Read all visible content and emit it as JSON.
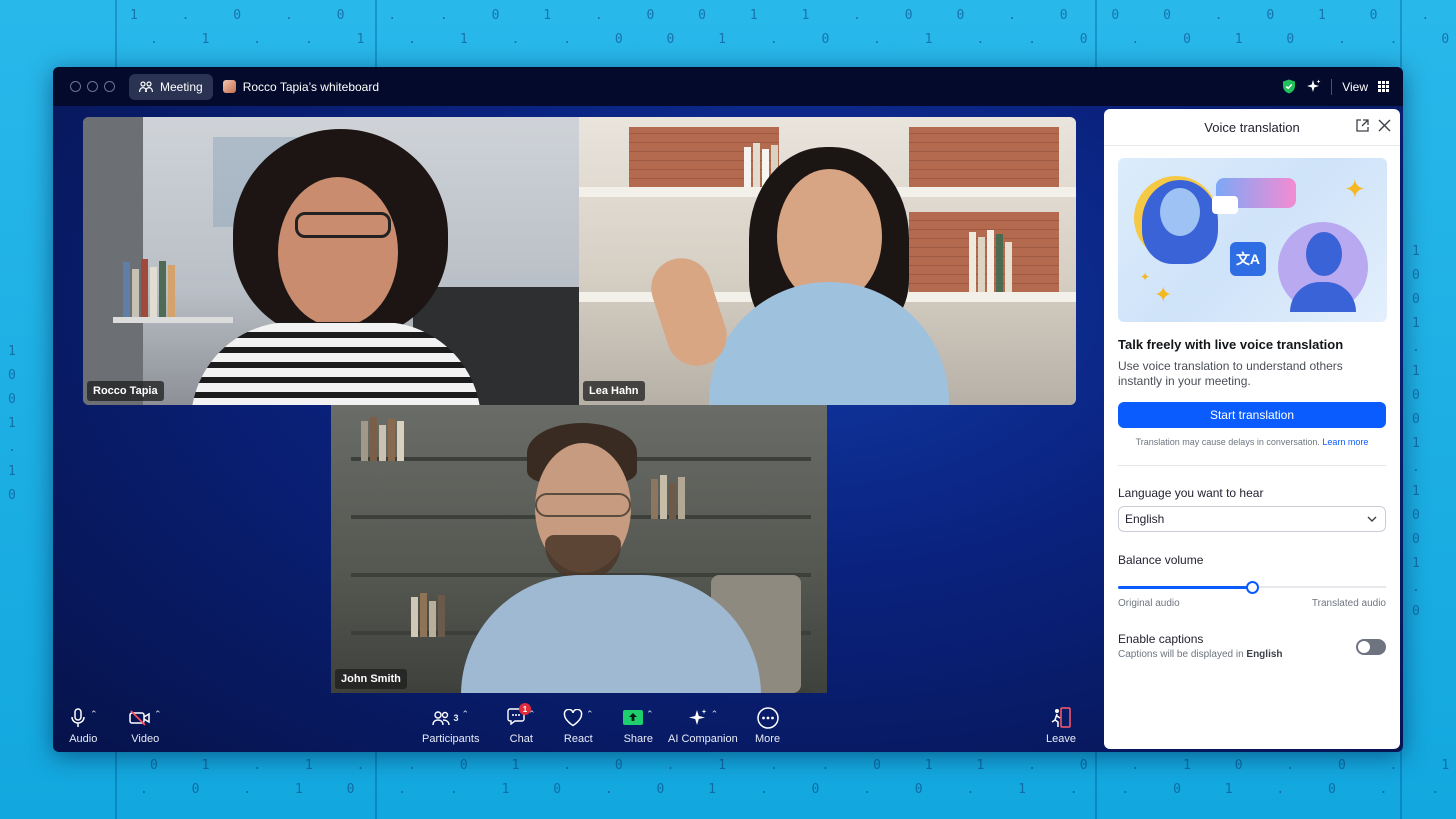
{
  "titlebar": {
    "meeting_label": "Meeting",
    "whiteboard_label": "Rocco Tapia’s whiteboard",
    "view_label": "View"
  },
  "participants": [
    {
      "name": "Rocco Tapia"
    },
    {
      "name": "Lea Hahn"
    },
    {
      "name": "John Smith"
    }
  ],
  "toolbar": {
    "audio": "Audio",
    "video": "Video",
    "participants": "Participants",
    "participants_count": "3",
    "chat": "Chat",
    "chat_badge": "1",
    "react": "React",
    "share": "Share",
    "ai_companion": "AI Companion",
    "more": "More",
    "leave": "Leave"
  },
  "panel": {
    "title": "Voice translation",
    "heading": "Talk freely with live voice translation",
    "description": "Use voice translation to understand others instantly in your meeting.",
    "start_button": "Start translation",
    "note": "Translation may cause delays in conversation.",
    "learn_more": "Learn more",
    "language_label": "Language you want to hear",
    "language_value": "English",
    "balance_label": "Balance volume",
    "balance_value": 0.5,
    "original_audio": "Original audio",
    "translated_audio": "Translated audio",
    "captions_label": "Enable captions",
    "captions_sub": "Captions will be displayed in",
    "captions_lang": "English",
    "captions_enabled": false
  },
  "colors": {
    "accent": "#0b5cff",
    "share_green": "#1fcf6d",
    "badge_red": "#e02b3a"
  }
}
